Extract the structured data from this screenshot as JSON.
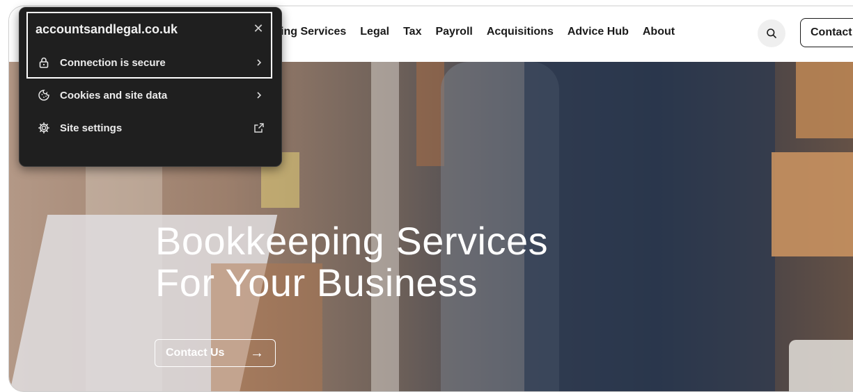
{
  "strip_colors": [
    "#f2a0c8",
    "#f2a0a0",
    "#a89be6",
    "#a8c4f0",
    "#f7e3a8",
    "#a8e0b0",
    "#a8e0e8"
  ],
  "header": {
    "nav": [
      "ing Services",
      "Legal",
      "Tax",
      "Payroll",
      "Acquisitions",
      "Advice Hub",
      "About"
    ],
    "search_icon": "search-icon",
    "contact_label": "Contact"
  },
  "hero": {
    "title_line1": "Bookkeeping Services",
    "title_line2": "For Your Business",
    "cta_label": "Contact Us",
    "cta_arrow": "→"
  },
  "popover": {
    "domain": "accountsandlegal.co.uk",
    "close_glyph": "✕",
    "items": [
      {
        "label": "Connection is secure",
        "icon": "lock-icon",
        "trail": "chevron-right-icon"
      },
      {
        "label": "Cookies and site data",
        "icon": "cookie-icon",
        "trail": "chevron-right-icon"
      },
      {
        "label": "Site settings",
        "icon": "gear-icon",
        "trail": "external-link-icon"
      }
    ]
  }
}
